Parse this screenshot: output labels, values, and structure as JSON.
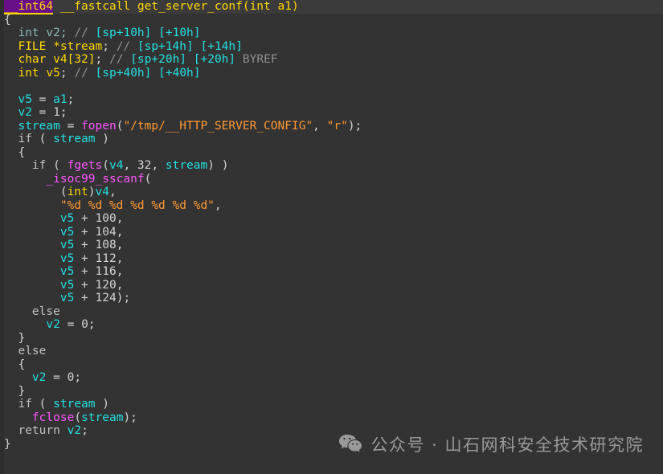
{
  "app": {
    "view": "IDA Pseudocode",
    "background_color": "#333333",
    "current_line_color": "#3b3b3b"
  },
  "colors": {
    "type": "#ffd700",
    "variable": "#22e0e0",
    "function_call": "#ff55ff",
    "string": "#ff9933",
    "comment": "#909090",
    "comment_location": "#22e0e0",
    "punctuation": "#d4d4d4",
    "keyword": "#c0c0c0",
    "highlight_background": "#6a0f8a",
    "declaration": "#8fb6b6"
  },
  "signature": {
    "return_type": "__int64",
    "calling_convention": "__fastcall",
    "name": "get_server_conf",
    "param_type": "int",
    "param_name": "a1",
    "highlighted_token": "__int64"
  },
  "declarations": [
    {
      "type": "int",
      "name": "v2",
      "semicolon": ";",
      "comment": "// ",
      "loc1": "[sp+10h]",
      "loc2": "[+10h]",
      "byref": ""
    },
    {
      "type": "FILE",
      "name": "*stream",
      "semicolon": ";",
      "comment": "// ",
      "loc1": "[sp+14h]",
      "loc2": "[+14h]",
      "byref": ""
    },
    {
      "type": "char",
      "name": "v4[32]",
      "semicolon": ";",
      "comment": "// ",
      "loc1": "[sp+20h]",
      "loc2": "[+20h]",
      "byref": "BYREF"
    },
    {
      "type": "int",
      "name": "v5",
      "semicolon": ";",
      "comment": "// ",
      "loc1": "[sp+40h]",
      "loc2": "[+40h]",
      "byref": ""
    }
  ],
  "code": {
    "open_brace": "{",
    "close_brace": "}",
    "assign_v5": {
      "lhs": "v5",
      "op": " = ",
      "rhs": "a1",
      "end": ";"
    },
    "assign_v2": {
      "lhs": "v2",
      "op": " = ",
      "rhs": "1",
      "end": ";"
    },
    "fopen_call": {
      "lhs": "stream",
      "op": " = ",
      "func": "fopen",
      "path": "\"/tmp/__HTTP_SERVER_CONFIG\"",
      "mode": "\"r\"",
      "end": ");"
    },
    "if_stream": {
      "kw": "if",
      "open": " ( ",
      "cond": "stream",
      "close": " )"
    },
    "if_fgets": {
      "kw": "if",
      "func": "fgets",
      "arg1": "v4",
      "arg2": "32",
      "arg3": "stream"
    },
    "sscanf": {
      "func": "_isoc99_sscanf",
      "cast_type": "int",
      "cast_var": "v4",
      "format": "\"%d %d %d %d %d %d %d\"",
      "args": [
        {
          "base": "v5",
          "op": " + ",
          "offset": "100",
          "end": ","
        },
        {
          "base": "v5",
          "op": " + ",
          "offset": "104",
          "end": ","
        },
        {
          "base": "v5",
          "op": " + ",
          "offset": "108",
          "end": ","
        },
        {
          "base": "v5",
          "op": " + ",
          "offset": "112",
          "end": ","
        },
        {
          "base": "v5",
          "op": " + ",
          "offset": "116",
          "end": ","
        },
        {
          "base": "v5",
          "op": " + ",
          "offset": "120",
          "end": ","
        },
        {
          "base": "v5",
          "op": " + ",
          "offset": "124",
          "end": ");"
        }
      ]
    },
    "else_kw": "else",
    "assign_v2_zero": {
      "lhs": "v2",
      "op": " = ",
      "rhs": "0",
      "end": ";"
    },
    "fclose_call": {
      "func": "fclose",
      "open": "(",
      "arg": "stream",
      "end": ");"
    },
    "return_stmt": {
      "kw": "return",
      "value": "v2",
      "end": ";"
    }
  },
  "watermark": {
    "icon": "wechat-icon",
    "text": "公众号 · 山石网科安全技术研究院"
  }
}
